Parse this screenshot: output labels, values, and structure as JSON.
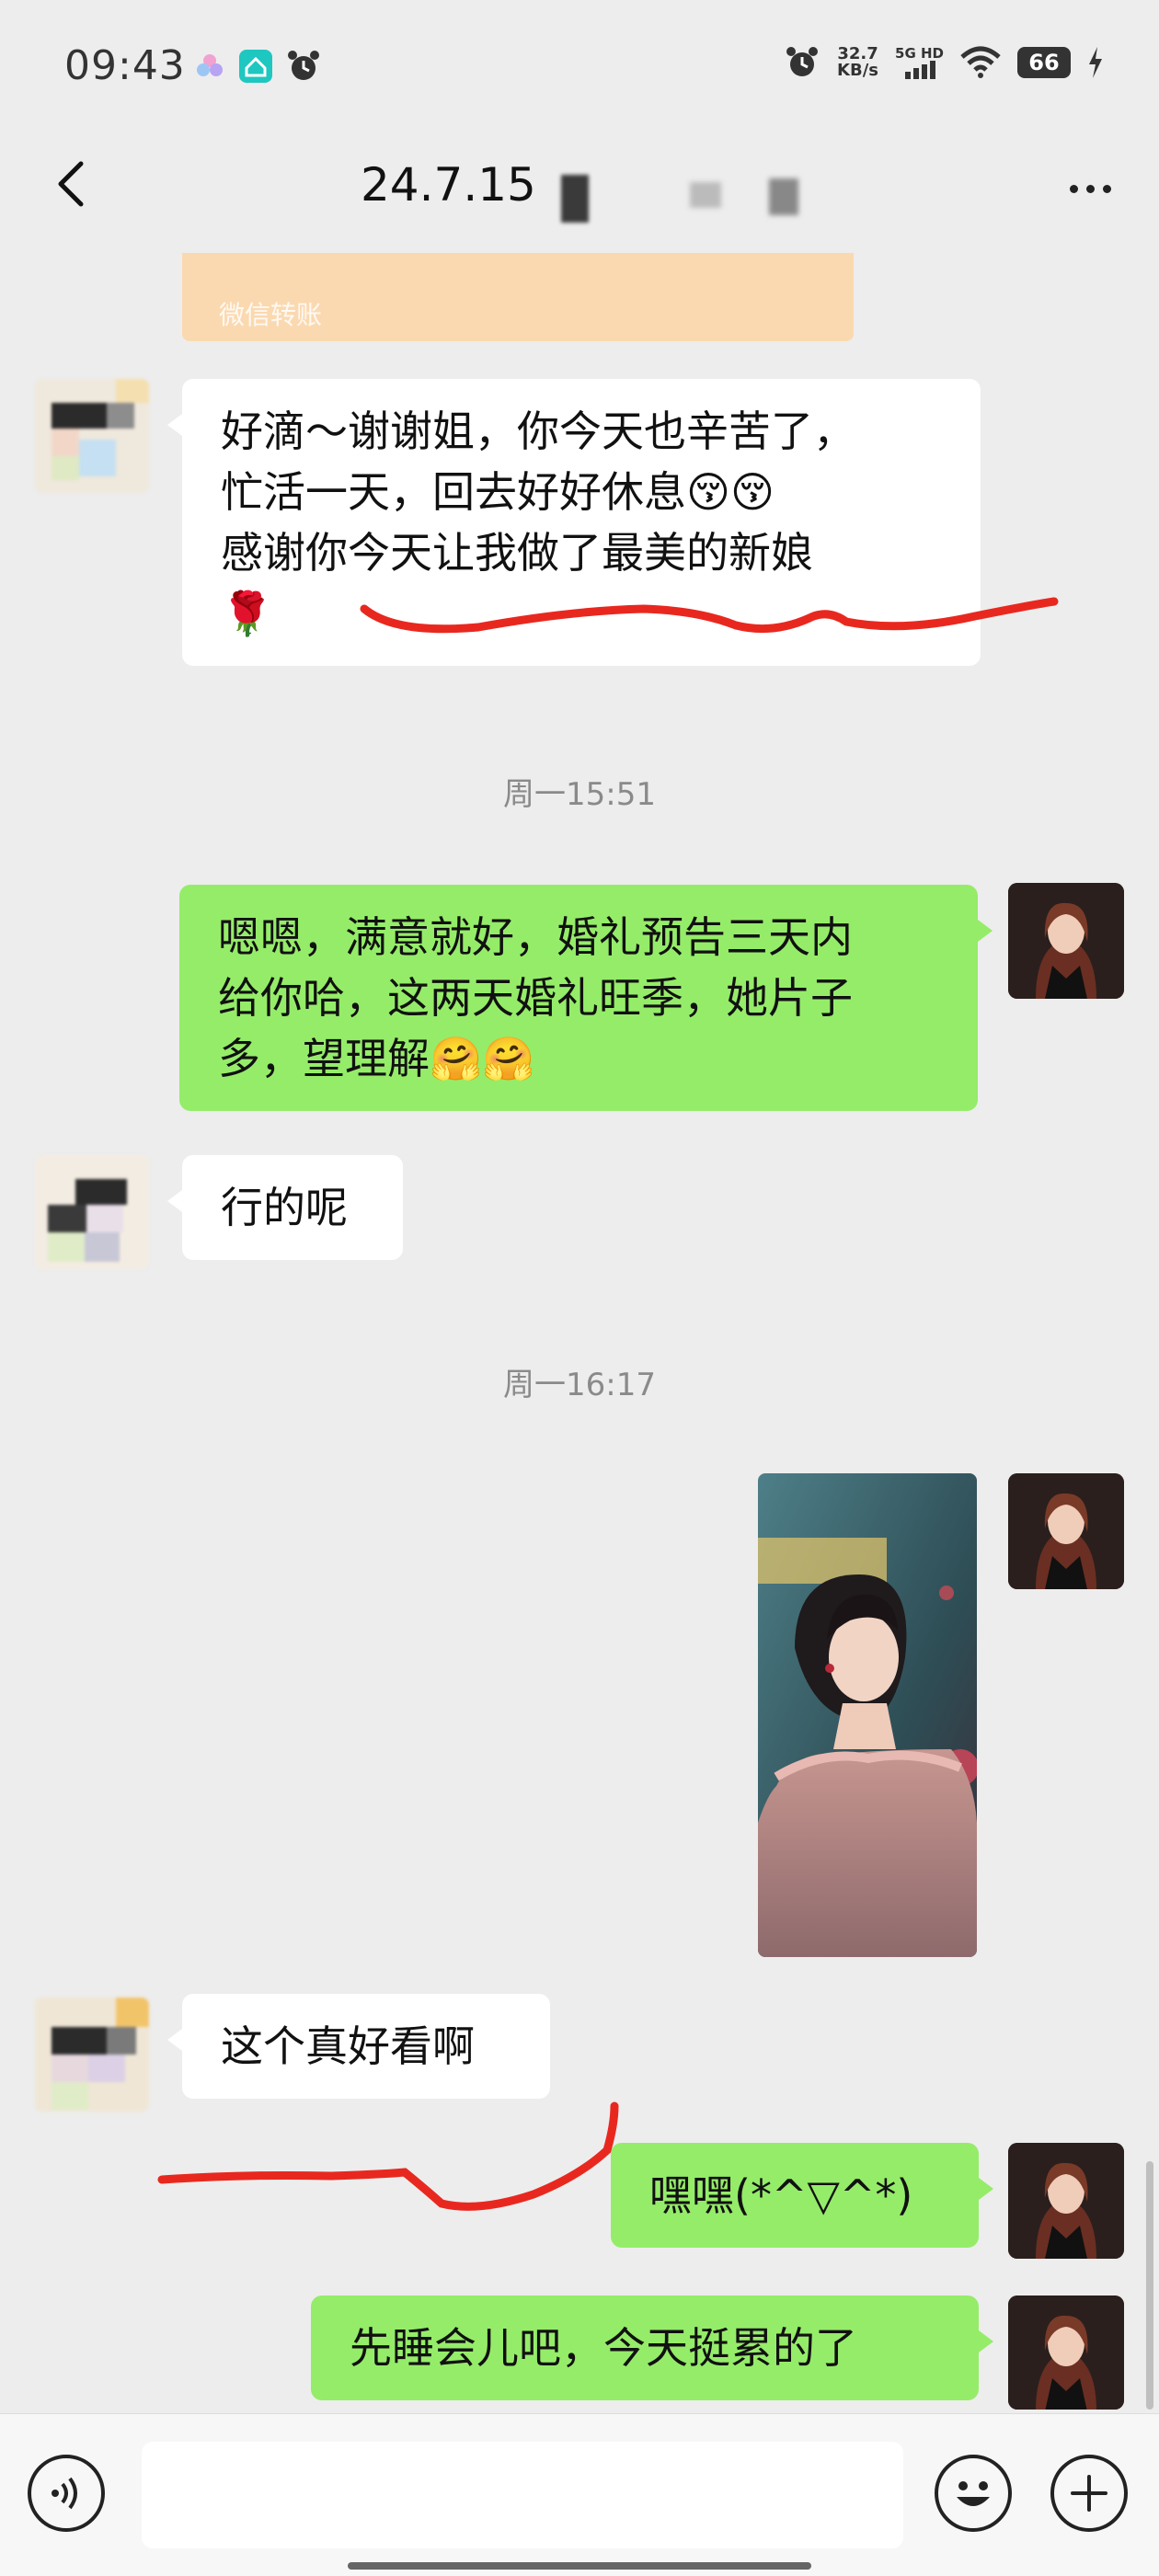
{
  "status_bar": {
    "time": "09:43",
    "net_speed_value": "32.7",
    "net_speed_unit": "KB/s",
    "network": "5G HD",
    "battery": "66"
  },
  "header": {
    "title": "24.7.15"
  },
  "messages": {
    "transfer_label": "微信转账",
    "m1": {
      "line1": "好滴～谢谢姐，你今天也辛苦了，",
      "line2": "忙活一天，回去好好休息😚😚",
      "line3": "感谢你今天让我做了最美的新娘",
      "line4": "🌹"
    },
    "ts1": "周一15:51",
    "m2": {
      "line1": "嗯嗯，满意就好，婚礼预告三天内",
      "line2": "给你哈，这两天婚礼旺季，她片子",
      "line3": "多，望理解🤗🤗"
    },
    "m3": "行的呢",
    "ts2": "周一16:17",
    "m4": "这个真好看啊",
    "m5": "嘿嘿(*^▽^*)",
    "m6": "先睡会儿吧，今天挺累的了"
  },
  "colors": {
    "bg": "#ededed",
    "outgoing_bubble": "#95ec69",
    "incoming_bubble": "#ffffff",
    "annotation": "#e8281f"
  }
}
